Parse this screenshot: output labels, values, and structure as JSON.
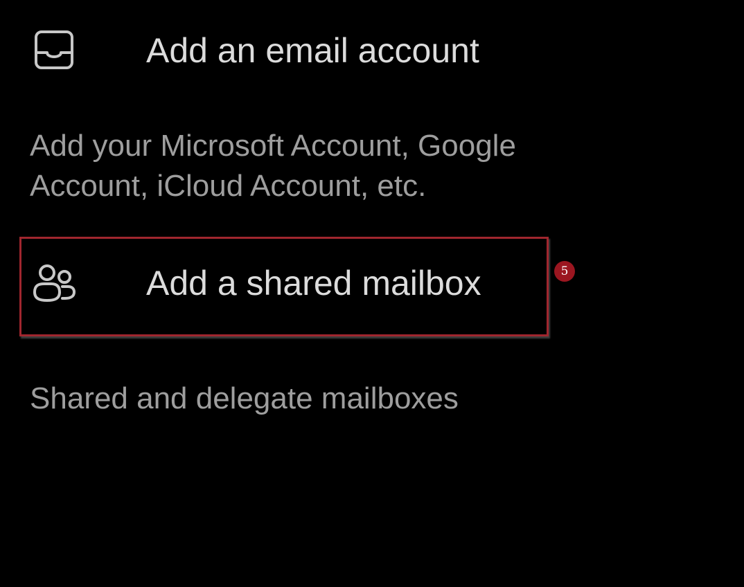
{
  "options": [
    {
      "label": "Add an email account",
      "icon": "inbox-icon",
      "description": "Add your Microsoft Account, Google Account, iCloud Account, etc.",
      "description_lines": [
        "Add your Microsoft Account, Google",
        "Account, iCloud Account, etc."
      ]
    },
    {
      "label": "Add a shared mailbox",
      "icon": "shared-people-icon",
      "description": "Shared and delegate mailboxes"
    }
  ],
  "annotation": {
    "marker_number": "5",
    "highlight_color": "#a0262e",
    "marker_color": "#9b1620"
  }
}
